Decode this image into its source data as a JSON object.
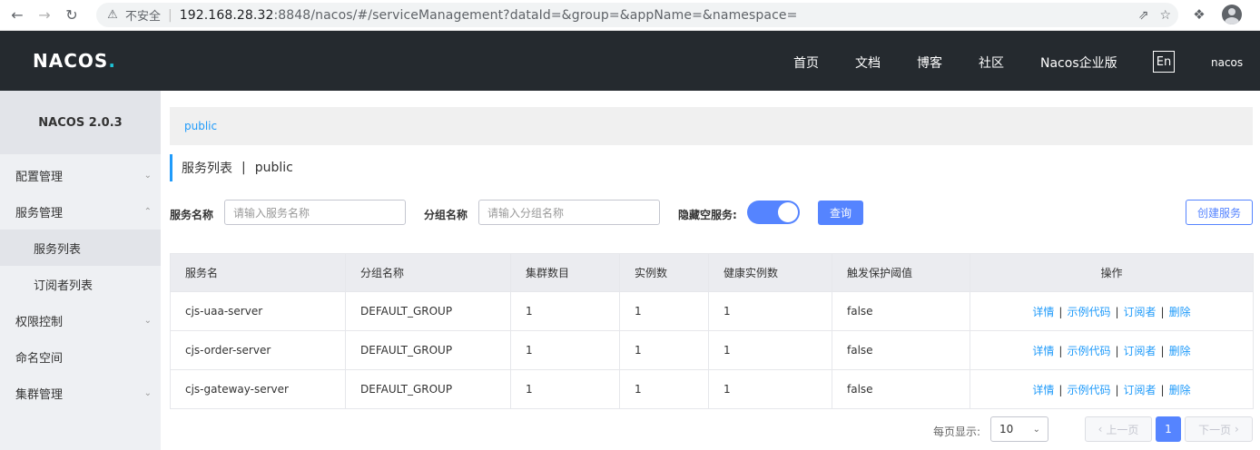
{
  "browser": {
    "insecure_label": "不安全",
    "url_host": "192.168.28.32",
    "url_rest": ":8848/nacos/#/serviceManagement?dataId=&group=&appName=&namespace="
  },
  "header": {
    "logo_main": "NACOS",
    "logo_dot": ".",
    "menu": [
      "首页",
      "文档",
      "博客",
      "社区",
      "Nacos企业版"
    ],
    "lang": "En",
    "user": "nacos"
  },
  "sidebar": {
    "title": "NACOS 2.0.3",
    "items": [
      {
        "label": "配置管理"
      },
      {
        "label": "服务管理"
      },
      {
        "label": "服务列表"
      },
      {
        "label": "订阅者列表"
      },
      {
        "label": "权限控制"
      },
      {
        "label": "命名空间"
      },
      {
        "label": "集群管理"
      }
    ]
  },
  "main": {
    "namespace": "public",
    "title": "服务列表",
    "title_sep": "|",
    "title_ns": "public",
    "filters": {
      "service_label": "服务名称",
      "service_placeholder": "请输入服务名称",
      "group_label": "分组名称",
      "group_placeholder": "请输入分组名称",
      "hide_empty_label": "隐藏空服务:",
      "query_button": "查询",
      "create_button": "创建服务"
    },
    "table": {
      "headers": [
        "服务名",
        "分组名称",
        "集群数目",
        "实例数",
        "健康实例数",
        "触发保护阈值",
        "操作"
      ],
      "rows": [
        [
          "cjs-uaa-server",
          "DEFAULT_GROUP",
          "1",
          "1",
          "1",
          "false"
        ],
        [
          "cjs-order-server",
          "DEFAULT_GROUP",
          "1",
          "1",
          "1",
          "false"
        ],
        [
          "cjs-gateway-server",
          "DEFAULT_GROUP",
          "1",
          "1",
          "1",
          "false"
        ]
      ],
      "ops": [
        "详情",
        "示例代码",
        "订阅者",
        "删除"
      ],
      "op_sep": "|"
    },
    "pagination": {
      "page_size_label": "每页显示:",
      "page_size": "10",
      "prev": "上一页",
      "current": "1",
      "next": "下一页"
    }
  }
}
